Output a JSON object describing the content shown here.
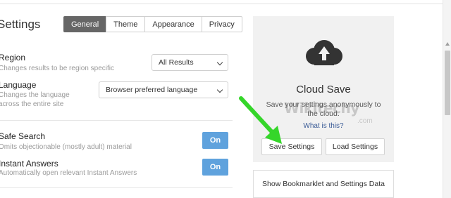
{
  "page": {
    "title": "Settings"
  },
  "tabs": [
    {
      "label": "General",
      "active": true
    },
    {
      "label": "Theme"
    },
    {
      "label": "Appearance"
    },
    {
      "label": "Privacy"
    }
  ],
  "region": {
    "label": "Region",
    "description": "Changes results to be region specific",
    "selected": "All Results"
  },
  "language": {
    "label": "Language",
    "description_line1": "Changes the language",
    "description_line2": "across the entire site",
    "selected": "Browser preferred language"
  },
  "safe_search": {
    "label": "Safe Search",
    "description": "Omits objectionable (mostly adult) material",
    "toggle": "On"
  },
  "instant_answers": {
    "label": "Instant Answers",
    "description": "Automatically open relevant Instant Answers",
    "toggle": "On"
  },
  "cloud_save": {
    "icon": "cloud-upload-icon",
    "title": "Cloud Save",
    "description": "Save your settings anonymously to the cloud.",
    "link": "What is this?",
    "save_button": "Save Settings",
    "load_button": "Load Settings"
  },
  "bookmarklet_button": "Show Bookmarklet and Settings Data",
  "watermark": {
    "main": "Wikitechy",
    "sub": ".com"
  },
  "annotation": {
    "icon": "green-arrow-icon",
    "color": "#35d62a"
  }
}
